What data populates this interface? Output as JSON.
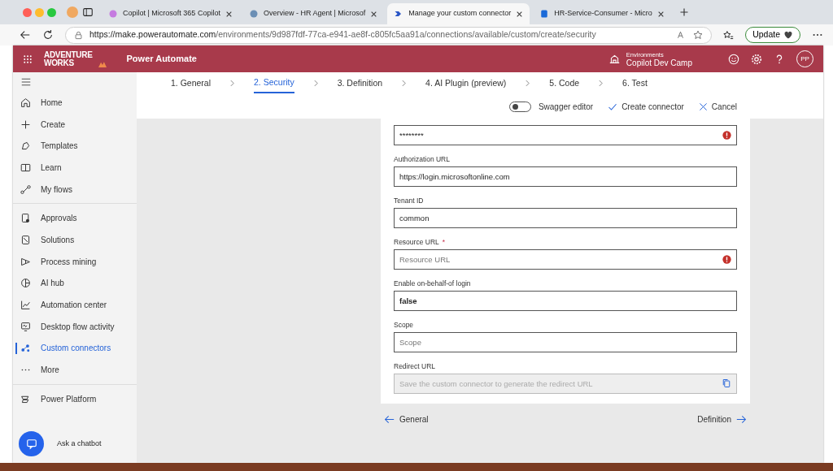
{
  "browser": {
    "tabs": [
      {
        "title": "Copilot | Microsoft 365 Copilot",
        "selected": false
      },
      {
        "title": "Overview - HR Agent | Microsof",
        "selected": false
      },
      {
        "title": "Manage your custom connector",
        "selected": true
      },
      {
        "title": "HR-Service-Consumer - Micro",
        "selected": false
      }
    ],
    "url_host": "https://make.powerautomate.com",
    "url_path": "/environments/9d987fdf-77ca-e941-ae8f-c805fc5aa91a/connections/available/custom/create/security",
    "update_label": "Update"
  },
  "header": {
    "logo_top": "ADVENTURE",
    "logo_bottom": "WORKS",
    "app_name": "Power Automate",
    "environment_caption": "Environments",
    "environment_name": "Copilot Dev Camp",
    "avatar": "PP"
  },
  "sidebar": {
    "groups": [
      [
        {
          "label": "Home",
          "selected": false
        },
        {
          "label": "Create",
          "selected": false
        },
        {
          "label": "Templates",
          "selected": false
        },
        {
          "label": "Learn",
          "selected": false
        },
        {
          "label": "My flows",
          "selected": false
        }
      ],
      [
        {
          "label": "Approvals",
          "selected": false
        },
        {
          "label": "Solutions",
          "selected": false
        },
        {
          "label": "Process mining",
          "selected": false
        },
        {
          "label": "AI hub",
          "selected": false
        },
        {
          "label": "Automation center",
          "selected": false
        },
        {
          "label": "Desktop flow activity",
          "selected": false
        },
        {
          "label": "Custom connectors",
          "selected": true
        },
        {
          "label": "More",
          "selected": false
        }
      ],
      [
        {
          "label": "Power Platform",
          "selected": false
        }
      ]
    ],
    "chatbot_label": "Ask a chatbot"
  },
  "steps": [
    {
      "label": "1. General",
      "selected": false
    },
    {
      "label": "2. Security",
      "selected": true
    },
    {
      "label": "3. Definition",
      "selected": false
    },
    {
      "label": "4. AI Plugin (preview)",
      "selected": false
    },
    {
      "label": "5. Code",
      "selected": false
    },
    {
      "label": "6. Test",
      "selected": false
    }
  ],
  "toolbar": {
    "swagger": {
      "label": "Swagger editor",
      "on": false
    },
    "create_label": "Create connector",
    "cancel_label": "Cancel"
  },
  "form": {
    "fields": [
      {
        "value": "********",
        "error": true,
        "disabled": false
      },
      {
        "label": "Authorization URL",
        "value": "https://login.microsoftonline.com",
        "disabled": false
      },
      {
        "label": "Tenant ID",
        "value": "common",
        "disabled": false
      },
      {
        "label": "Resource URL",
        "required_mark": "*",
        "placeholder": "Resource URL",
        "error": true,
        "disabled": false
      },
      {
        "label": "Enable on-behalf-of login",
        "value": "false",
        "disabled": false
      },
      {
        "label": "Scope",
        "placeholder": "Scope",
        "disabled": false
      },
      {
        "label": "Redirect URL",
        "placeholder": "Save the custom connector to generate the redirect URL",
        "disabled": true,
        "copy": true
      }
    ]
  },
  "footer": {
    "back_label": "General",
    "next_label": "Definition"
  }
}
